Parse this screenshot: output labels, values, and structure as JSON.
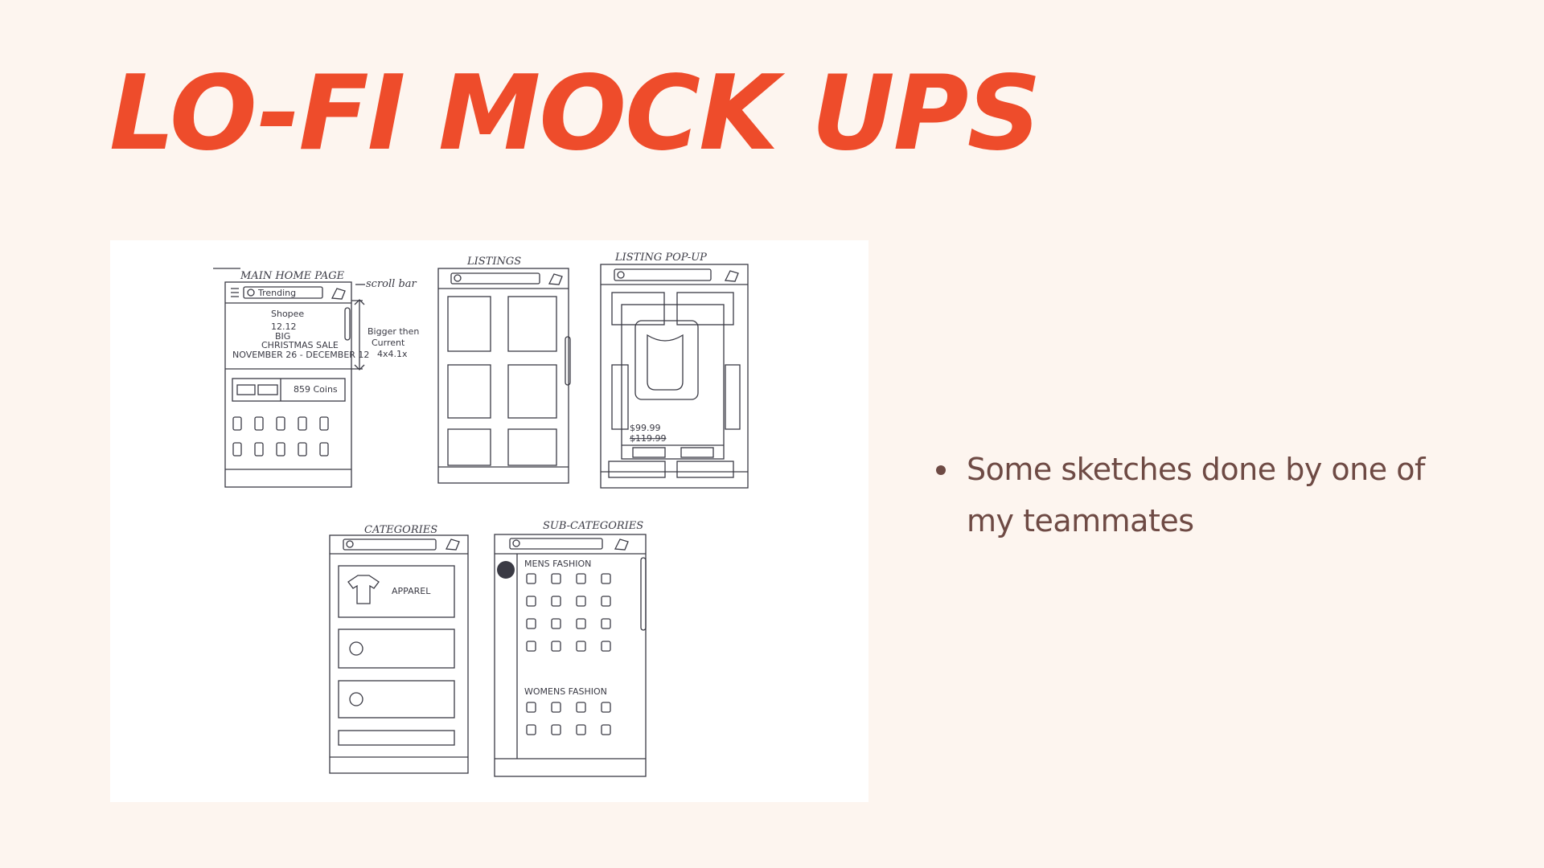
{
  "slide": {
    "title": "LO-FI MOCK UPS",
    "bullets": [
      "Some sketches done by one of my teammates"
    ]
  },
  "sketches": {
    "labels": {
      "main_home": "MAIN HOME PAGE",
      "listings": "LISTINGS",
      "listing_popup": "LISTING POP-UP",
      "categories": "CATEGORIES",
      "sub_categories": "SUB-CATEGORIES",
      "annot_scroll": "scroll bar",
      "annot_banner_1": "Bigger then",
      "annot_banner_2": "Current",
      "annot_banner_3": "4x4.1x",
      "banner_1": "Shopee",
      "banner_2": "12.12",
      "banner_3": "BIG",
      "banner_4": "CHRISTMAS SALE",
      "banner_5": "NOVEMBER 26 - DECEMBER 12",
      "coins": "859 Coins",
      "search": "Trending",
      "price": "$99.99",
      "price_old": "$119.99",
      "apparel": "APPAREL",
      "mens": "MENS FASHION",
      "womens": "WOMENS FASHION"
    }
  }
}
